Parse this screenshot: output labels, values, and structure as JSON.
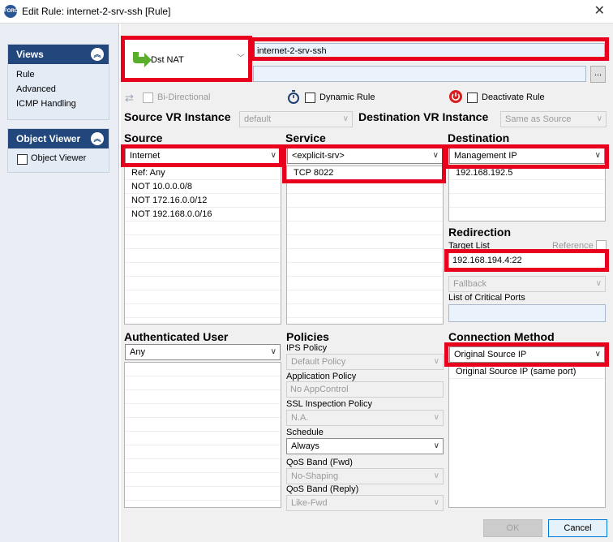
{
  "window": {
    "title": "Edit Rule: internet-2-srv-ssh [Rule]",
    "icon_text": "FORC"
  },
  "sidebar": {
    "views": {
      "title": "Views",
      "items": [
        "Rule",
        "Advanced",
        "ICMP Handling"
      ]
    },
    "object_viewer": {
      "title": "Object Viewer",
      "checkbox_label": "Object Viewer"
    }
  },
  "rule": {
    "action": "Dst NAT",
    "name": "internet-2-srv-ssh",
    "description": "",
    "more_button": "...",
    "bidirectional": "Bi-Directional",
    "dynamic_rule": "Dynamic Rule",
    "deactivate_rule": "Deactivate Rule"
  },
  "vr": {
    "source_label": "Source VR Instance",
    "source_value": "default",
    "destination_label": "Destination VR Instance",
    "destination_value": "Same as Source"
  },
  "source": {
    "label": "Source",
    "selected": "Internet",
    "items": [
      "Ref: Any",
      "NOT 10.0.0.0/8",
      "NOT 172.16.0.0/12",
      "NOT 192.168.0.0/16"
    ]
  },
  "service": {
    "label": "Service",
    "selected": "<explicit-srv>",
    "items": [
      "TCP  8022"
    ]
  },
  "destination": {
    "label": "Destination",
    "selected": "Management IP",
    "items": [
      "192.168.192.5"
    ]
  },
  "redirection": {
    "label": "Redirection",
    "target_list_label": "Target List",
    "reference_label": "Reference",
    "target_value": "192.168.194.4:22",
    "fallback": "Fallback",
    "critical_ports_label": "List of Critical Ports"
  },
  "auth_user": {
    "label": "Authenticated User",
    "selected": "Any"
  },
  "policies": {
    "label": "Policies",
    "ips_label": "IPS Policy",
    "ips_value": "Default Policy",
    "app_label": "Application Policy",
    "app_value": "No AppControl",
    "ssl_label": "SSL Inspection Policy",
    "ssl_value": "N.A.",
    "schedule_label": "Schedule",
    "schedule_value": "Always",
    "qos_fwd_label": "QoS Band (Fwd)",
    "qos_fwd_value": "No-Shaping",
    "qos_reply_label": "QoS Band (Reply)",
    "qos_reply_value": "Like-Fwd"
  },
  "connection": {
    "label": "Connection Method",
    "selected": "Original Source IP",
    "items": [
      "Original Source IP (same port)"
    ]
  },
  "buttons": {
    "ok": "OK",
    "cancel": "Cancel"
  },
  "colors": {
    "highlight": "#e8001c",
    "panel_header": "#21477d",
    "green_arrow": "#5aae2b",
    "deactivate_icon": "#d81e1e"
  }
}
